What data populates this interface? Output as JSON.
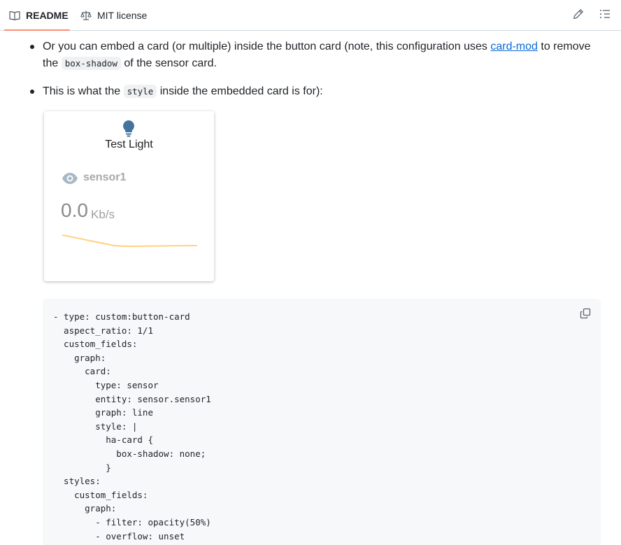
{
  "tabs": {
    "readme": {
      "label": "README",
      "icon": "book-icon"
    },
    "license": {
      "label": "MIT license",
      "icon": "scale-icon"
    }
  },
  "toolbar": {
    "edit_icon": "pencil-icon",
    "outline_icon": "list-icon"
  },
  "content": {
    "bullet1": {
      "part1": "Or you can embed a card (or multiple) inside the button card (note, this configuration uses ",
      "link": "card-mod",
      "part2": " to remove the ",
      "code": "box-shadow",
      "part3": " of the sensor card."
    },
    "bullet2": {
      "part1": "This is what the ",
      "code": "style",
      "part2": " inside the embedded card is for):"
    }
  },
  "card": {
    "title": "Test Light",
    "bulb_icon": "lightbulb-icon",
    "bulb_color": "#44739e",
    "sensor_icon": "eye-icon",
    "sensor_name": "sensor1",
    "value": "0.0",
    "unit": "Kb/s",
    "graph_color": "#ffd184"
  },
  "code": {
    "copy_icon": "copy-icon",
    "lines": [
      "- type: custom:button-card",
      "  aspect_ratio: 1/1",
      "  custom_fields:",
      "    graph:",
      "      card:",
      "        type: sensor",
      "        entity: sensor.sensor1",
      "        graph: line",
      "        style: |",
      "          ha-card {",
      "            box-shadow: none;",
      "          }",
      "  styles:",
      "    custom_fields:",
      "      graph:",
      "        - filter: opacity(50%)",
      "        - overflow: unset"
    ]
  }
}
